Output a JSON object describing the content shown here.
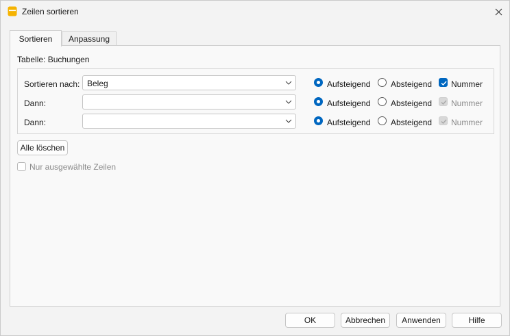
{
  "window": {
    "title": "Zeilen sortieren"
  },
  "tabs": [
    {
      "label": "Sortieren",
      "active": true
    },
    {
      "label": "Anpassung",
      "active": false
    }
  ],
  "panel": {
    "table_label": "Tabelle: Buchungen",
    "rows": [
      {
        "label": "Sortieren nach:",
        "value": "Beleg",
        "ascending_label": "Aufsteigend",
        "descending_label": "Absteigend",
        "number_label": "Nummer",
        "ascending_selected": true,
        "number_checked": true,
        "number_enabled": true
      },
      {
        "label": "Dann:",
        "value": "",
        "ascending_label": "Aufsteigend",
        "descending_label": "Absteigend",
        "number_label": "Nummer",
        "ascending_selected": true,
        "number_checked": true,
        "number_enabled": false
      },
      {
        "label": "Dann:",
        "value": "",
        "ascending_label": "Aufsteigend",
        "descending_label": "Absteigend",
        "number_label": "Nummer",
        "ascending_selected": true,
        "number_checked": true,
        "number_enabled": false
      }
    ],
    "clear_all_label": "Alle löschen",
    "selected_rows_only_label": "Nur ausgewählte Zeilen",
    "selected_rows_only_checked": false
  },
  "footer": {
    "ok_label": "OK",
    "cancel_label": "Abbrechen",
    "apply_label": "Anwenden",
    "help_label": "Hilfe"
  },
  "colors": {
    "accent": "#0067c0",
    "app_icon": "#f5b301"
  }
}
